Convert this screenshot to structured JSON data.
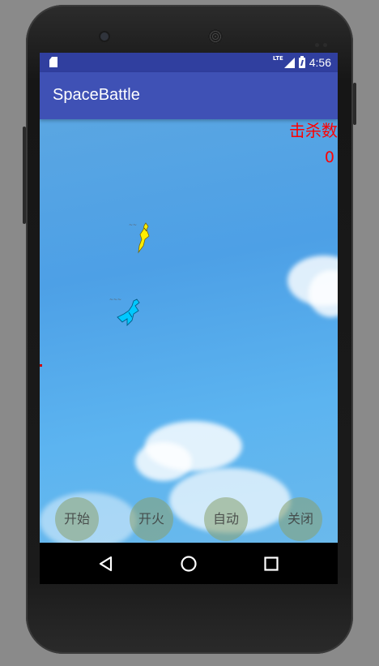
{
  "status_bar": {
    "network": "LTE",
    "time": "4:56",
    "icons": [
      "sd-card-icon",
      "signal-icon",
      "battery-icon"
    ]
  },
  "app_bar": {
    "title": "SpaceBattle"
  },
  "game": {
    "kill_label": "击杀数",
    "kill_count": "0",
    "kill_color": "#ff0000",
    "sky_color": "#4da0e6",
    "ships": [
      {
        "name": "yellow-ship",
        "color": "#ffee00"
      },
      {
        "name": "cyan-ship",
        "color": "#00c8ff"
      }
    ]
  },
  "controls": {
    "start": "开始",
    "fire": "开火",
    "auto": "自动",
    "close": "关闭"
  },
  "nav_bar": {
    "icons": [
      "back-icon",
      "home-icon",
      "recents-icon"
    ]
  }
}
